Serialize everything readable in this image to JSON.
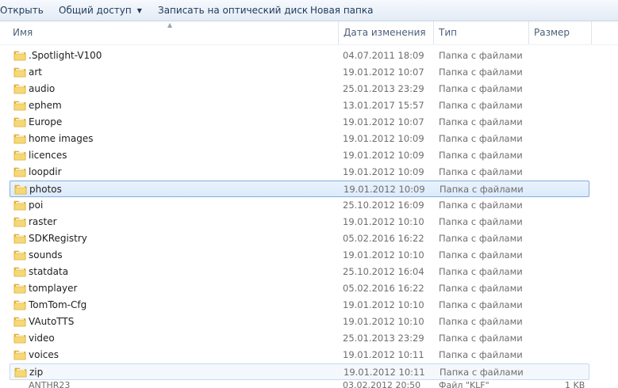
{
  "toolbar": {
    "open_label": "Открыть",
    "share_label": "Общий доступ",
    "burn_label": "Записать на оптический диск",
    "new_folder_label": "Новая папка"
  },
  "columns": {
    "name": "Имя",
    "date": "Дата изменения",
    "type": "Тип",
    "size": "Размер"
  },
  "files": [
    {
      "name": ".Spotlight-V100",
      "date": "04.07.2011 18:09",
      "type": "Папка с файлами"
    },
    {
      "name": "art",
      "date": "19.01.2012 10:07",
      "type": "Папка с файлами"
    },
    {
      "name": "audio",
      "date": "25.01.2013 23:29",
      "type": "Папка с файлами"
    },
    {
      "name": "ephem",
      "date": "13.01.2017 15:57",
      "type": "Папка с файлами"
    },
    {
      "name": "Europe",
      "date": "19.01.2012 10:07",
      "type": "Папка с файлами"
    },
    {
      "name": "home images",
      "date": "19.01.2012 10:09",
      "type": "Папка с файлами"
    },
    {
      "name": "licences",
      "date": "19.01.2012 10:09",
      "type": "Папка с файлами"
    },
    {
      "name": "loopdir",
      "date": "19.01.2012 10:09",
      "type": "Папка с файлами"
    },
    {
      "name": "photos",
      "date": "19.01.2012 10:09",
      "type": "Папка с файлами",
      "state": "selected"
    },
    {
      "name": "poi",
      "date": "25.10.2012 16:09",
      "type": "Папка с файлами"
    },
    {
      "name": "raster",
      "date": "19.01.2012 10:10",
      "type": "Папка с файлами"
    },
    {
      "name": "SDKRegistry",
      "date": "05.02.2016 16:22",
      "type": "Папка с файлами"
    },
    {
      "name": "sounds",
      "date": "19.01.2012 10:10",
      "type": "Папка с файлами"
    },
    {
      "name": "statdata",
      "date": "25.10.2012 16:04",
      "type": "Папка с файлами"
    },
    {
      "name": "tomplayer",
      "date": "05.02.2016 16:22",
      "type": "Папка с файлами"
    },
    {
      "name": "TomTom-Cfg",
      "date": "19.01.2012 10:10",
      "type": "Папка с файлами"
    },
    {
      "name": "VAutoTTS",
      "date": "19.01.2012 10:10",
      "type": "Папка с файлами"
    },
    {
      "name": "video",
      "date": "25.01.2013 23:29",
      "type": "Папка с файлами"
    },
    {
      "name": "voices",
      "date": "19.01.2012 10:11",
      "type": "Папка с файлами"
    },
    {
      "name": "zip",
      "date": "19.01.2012 10:11",
      "type": "Папка с файлами",
      "state": "hover"
    }
  ],
  "partial_row": {
    "name": "ANTHR23",
    "date": "03.02.2012 20:50",
    "type": "Файл \"KLF\"",
    "size": "1 KB"
  },
  "colors": {
    "selection_border": "#84acdd",
    "selection_fill": "#dbeafb",
    "folder_yellow": "#f0c84a",
    "header_text": "#4c607a",
    "toolbar_text": "#1e395b"
  },
  "icons": {
    "folder": "folder-icon",
    "share_dropdown": "chevron-down-icon",
    "sort": "sort-up-icon"
  }
}
